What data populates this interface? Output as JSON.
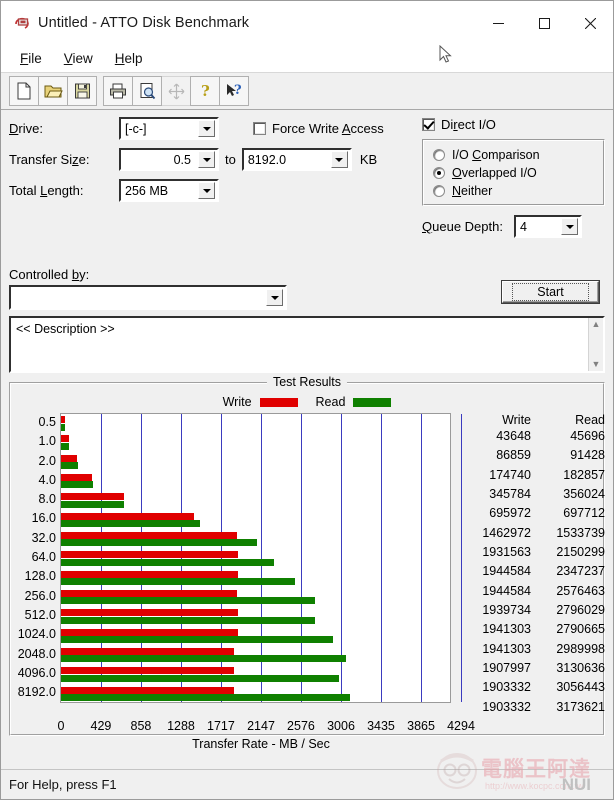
{
  "window": {
    "title": "Untitled - ATTO Disk Benchmark",
    "icon": "atto-app-icon",
    "minimize": "—",
    "maximize": "☐",
    "close": "✕"
  },
  "menubar": [
    {
      "label": "File",
      "mnemonic": "F"
    },
    {
      "label": "View",
      "mnemonic": "V"
    },
    {
      "label": "Help",
      "mnemonic": "H"
    }
  ],
  "toolbar": [
    {
      "name": "new-document-icon",
      "enabled": true
    },
    {
      "name": "open-folder-icon",
      "enabled": true
    },
    {
      "name": "save-disk-icon",
      "enabled": true
    },
    {
      "name": "print-icon",
      "enabled": true
    },
    {
      "name": "print-preview-icon",
      "enabled": true
    },
    {
      "name": "move-icon",
      "enabled": false
    },
    {
      "name": "about-question-icon",
      "enabled": true
    },
    {
      "name": "context-help-icon",
      "enabled": true
    }
  ],
  "settings": {
    "drive_label": "Drive:",
    "drive_value": "[-c-]",
    "transfer_size_label": "Transfer Size:",
    "transfer_size_from": "0.5",
    "transfer_size_to_label": "to",
    "transfer_size_to": "8192.0",
    "transfer_size_unit": "KB",
    "total_length_label": "Total Length:",
    "total_length_value": "256 MB",
    "force_write_access_label": "Force Write Access",
    "force_write_access_checked": false,
    "direct_io_label": "Direct I/O",
    "direct_io_checked": true,
    "io_modes": [
      {
        "label": "I/O Comparison",
        "selected": false
      },
      {
        "label": "Overlapped I/O",
        "selected": true
      },
      {
        "label": "Neither",
        "selected": false
      }
    ],
    "queue_depth_label": "Queue Depth:",
    "queue_depth_value": "4",
    "controlled_by_label": "Controlled by:",
    "controlled_by_value": "",
    "start_button": "Start",
    "description_text": "<< Description >>"
  },
  "results": {
    "group_title": "Test Results",
    "legend": [
      {
        "label": "Write",
        "color": "#e00000"
      },
      {
        "label": "Read",
        "color": "#0f8000"
      }
    ],
    "col_write": "Write",
    "col_read": "Read"
  },
  "statusbar": {
    "text": "For Help, press F1"
  },
  "watermark": {
    "cn": "電腦王阿達",
    "url": "http://www.kocpc.com.tw",
    "nui": "NUI"
  },
  "chart_data": {
    "type": "bar",
    "title": "Test Results",
    "xlabel": "Transfer Rate - MB / Sec",
    "ylabel": "",
    "orientation": "horizontal",
    "categories": [
      "0.5",
      "1.0",
      "2.0",
      "4.0",
      "8.0",
      "16.0",
      "32.0",
      "64.0",
      "128.0",
      "256.0",
      "512.0",
      "1024.0",
      "2048.0",
      "4096.0",
      "8192.0"
    ],
    "xticks": [
      0,
      429,
      858,
      1288,
      1717,
      2147,
      2576,
      3006,
      3435,
      3865,
      4294
    ],
    "xlim": [
      0,
      4294
    ],
    "grid": true,
    "legend_position": "top",
    "units": "KB/s",
    "series": [
      {
        "name": "Write",
        "color": "#e00000",
        "values": [
          43648,
          86859,
          174740,
          345784,
          695972,
          1462972,
          1931563,
          1944584,
          1944584,
          1939734,
          1941303,
          1941303,
          1907997,
          1903332,
          1903332
        ]
      },
      {
        "name": "Read",
        "color": "#0f8000",
        "values": [
          45696,
          91428,
          182857,
          356024,
          697712,
          1533739,
          2150299,
          2347237,
          2576463,
          2796029,
          2790665,
          2989998,
          3130636,
          3056443,
          3173621
        ]
      }
    ]
  }
}
